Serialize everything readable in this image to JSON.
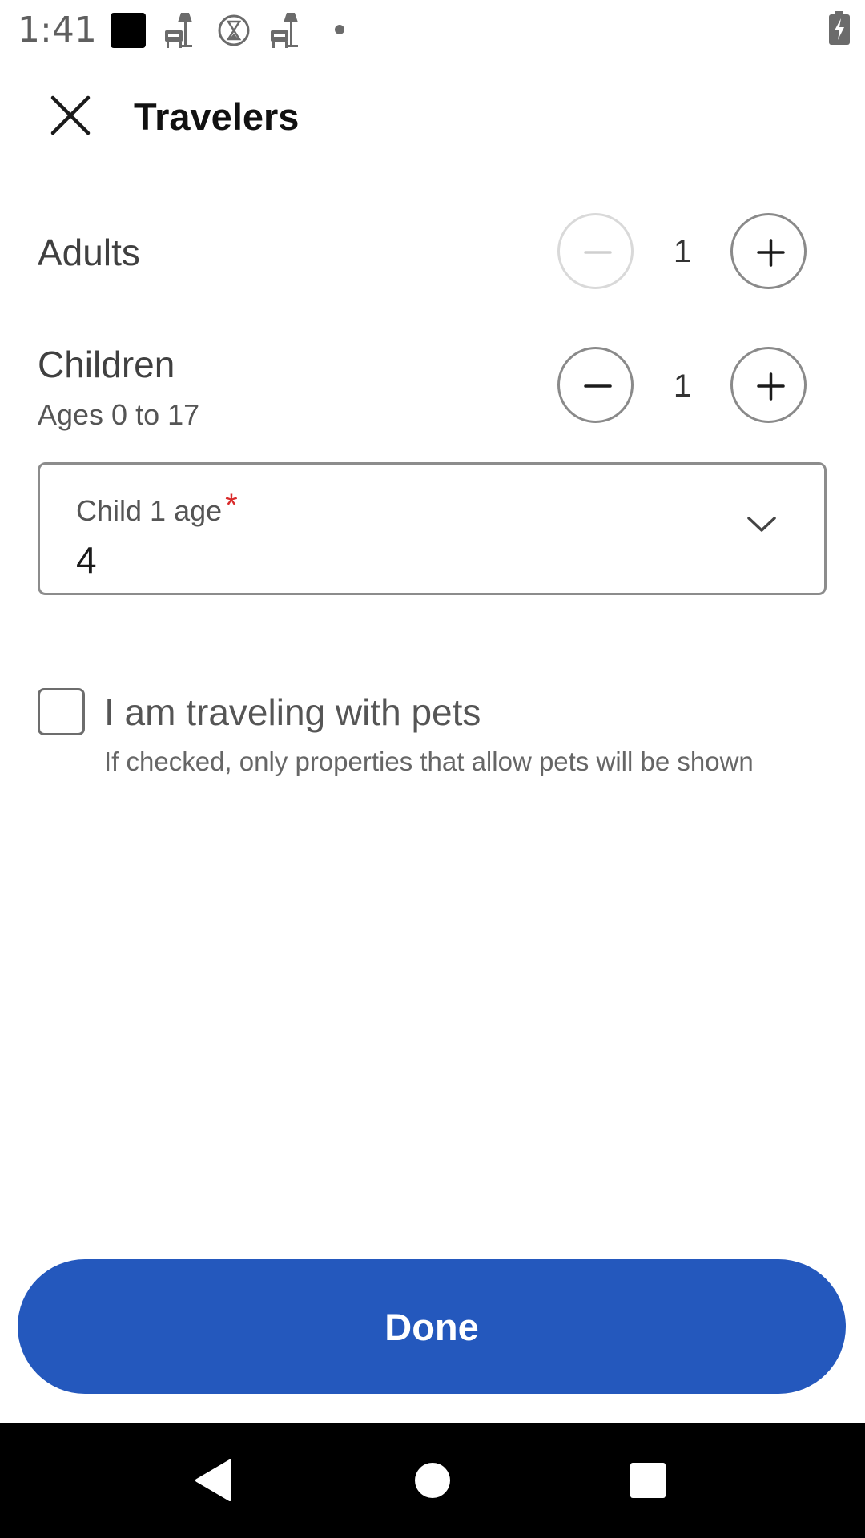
{
  "status_bar": {
    "time": "1:41",
    "icons": [
      "notification-square-icon",
      "lamp-icon",
      "hourglass-icon",
      "lamp-icon",
      "dot-icon"
    ],
    "battery": "battery-charging-icon"
  },
  "header": {
    "title": "Travelers",
    "close_icon": "close-icon"
  },
  "adults": {
    "label": "Adults",
    "count": "1",
    "decrement_disabled": true
  },
  "children": {
    "label": "Children",
    "sublabel": "Ages 0 to 17",
    "count": "1"
  },
  "child_age": {
    "label": "Child 1 age",
    "required_mark": "*",
    "value": "4"
  },
  "pets": {
    "label": "I am traveling with pets",
    "hint": "If checked, only properties that allow pets will be shown",
    "checked": false
  },
  "done_button": {
    "label": "Done",
    "color": "#2458bd"
  },
  "nav_bar": {
    "icons": [
      "back-icon",
      "home-icon",
      "recents-icon"
    ]
  }
}
